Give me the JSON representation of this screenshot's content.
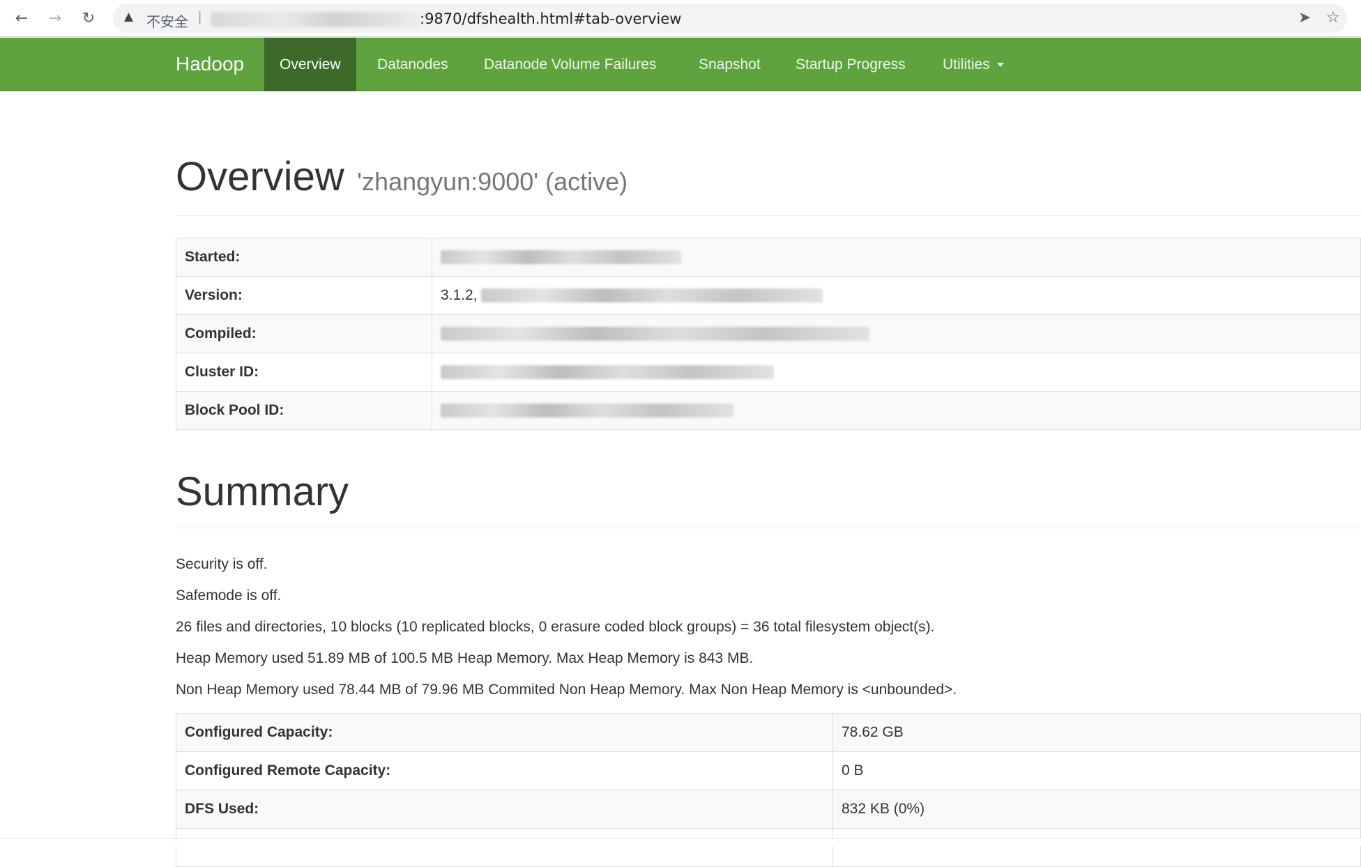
{
  "browser": {
    "back_icon": "arrow-left-icon",
    "forward_icon": "arrow-right-icon",
    "reload_icon": "reload-icon",
    "security_warning": "不安全",
    "url_visible": ":9870/dfshealth.html#tab-overview",
    "send_icon": "send-icon",
    "bookmark_icon": "star-icon"
  },
  "navbar": {
    "brand": "Hadoop",
    "items": [
      {
        "label": "Overview",
        "active": true
      },
      {
        "label": "Datanodes",
        "active": false
      },
      {
        "label": "Datanode Volume Failures",
        "active": false
      },
      {
        "label": "Snapshot",
        "active": false
      },
      {
        "label": "Startup Progress",
        "active": false
      },
      {
        "label": "Utilities",
        "active": false,
        "dropdown": true
      }
    ],
    "color": "#5fa33e",
    "active_color": "#3b6a2b"
  },
  "overview": {
    "title": "Overview",
    "subtitle": "'zhangyun:9000' (active)",
    "rows": [
      {
        "key": "Started:",
        "value": ""
      },
      {
        "key": "Version:",
        "value": "3.1.2, "
      },
      {
        "key": "Compiled:",
        "value": ""
      },
      {
        "key": "Cluster ID:",
        "value": ""
      },
      {
        "key": "Block Pool ID:",
        "value": ""
      }
    ]
  },
  "summary": {
    "title": "Summary",
    "lines": [
      "Security is off.",
      "Safemode is off.",
      "26 files and directories, 10 blocks (10 replicated blocks, 0 erasure coded block groups) = 36 total filesystem object(s).",
      "Heap Memory used 51.89 MB of 100.5 MB Heap Memory. Max Heap Memory is 843 MB.",
      "Non Heap Memory used 78.44 MB of 79.96 MB Commited Non Heap Memory. Max Non Heap Memory is <unbounded>."
    ],
    "rows": [
      {
        "key": "Configured Capacity:",
        "value": "78.62 GB"
      },
      {
        "key": "Configured Remote Capacity:",
        "value": "0 B"
      },
      {
        "key": "DFS Used:",
        "value": "832 KB (0%)"
      }
    ]
  }
}
